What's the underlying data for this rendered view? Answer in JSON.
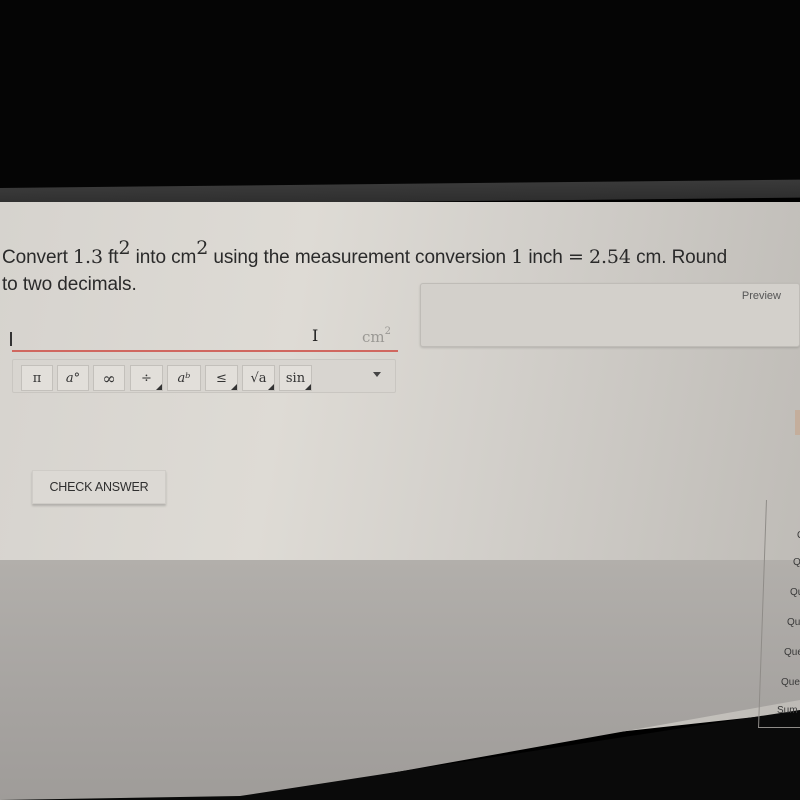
{
  "question": {
    "prefix": "Convert",
    "value": "1.3",
    "unit_from": "ft",
    "unit_from_exp": "2",
    "into": "into",
    "unit_to": "cm",
    "unit_to_exp": "2",
    "middle": "using the measurement conversion",
    "conv_lhs_num": "1",
    "conv_lhs_unit": "inch",
    "equals": "=",
    "conv_rhs_num": "2.54",
    "conv_rhs_unit": "cm. Round",
    "line2": "to two decimals."
  },
  "answer": {
    "value": "",
    "unit": "cm",
    "unit_exp": "2"
  },
  "toolbar": {
    "buttons": [
      {
        "label": "π",
        "name": "pi"
      },
      {
        "label": "a°",
        "name": "degree"
      },
      {
        "label": "∞",
        "name": "infinity"
      },
      {
        "label": "÷",
        "name": "divide"
      },
      {
        "label": "aᵇ",
        "name": "exponent"
      },
      {
        "label": "≤",
        "name": "less-equal"
      },
      {
        "label": "√a",
        "name": "sqrt"
      },
      {
        "label": "sin",
        "name": "sin"
      }
    ]
  },
  "preview": {
    "label": "Preview"
  },
  "check_answer": {
    "label": "CHECK ANSWER"
  },
  "side_nav": {
    "items": [
      "Q",
      "Q",
      "Qu",
      "Qu",
      "Que",
      "Que",
      "Sum"
    ]
  },
  "colors": {
    "underline_accent": "#d0675f",
    "background": "#d6d3ce"
  }
}
